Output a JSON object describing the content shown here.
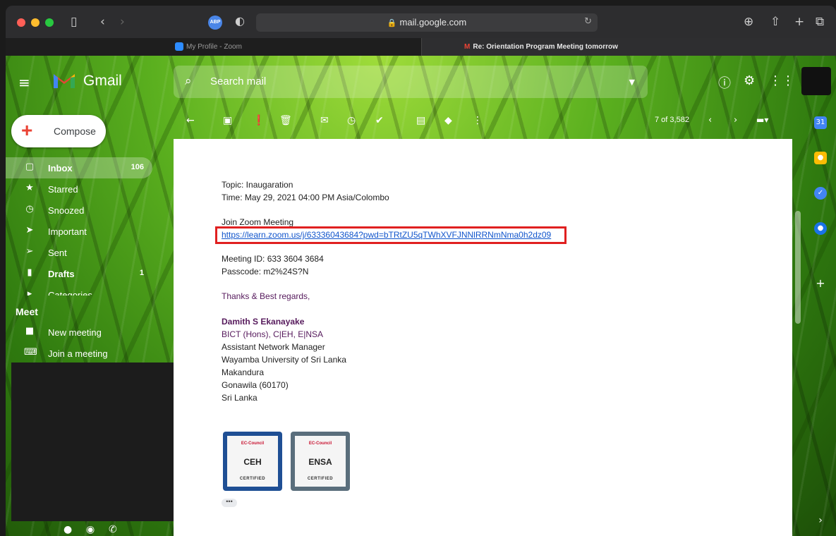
{
  "browser": {
    "url": "mail.google.com",
    "tabs": [
      {
        "label": "My Profile - Zoom"
      },
      {
        "label": "Re: Orientation Program Meeting tomorrow"
      }
    ]
  },
  "gmail": {
    "app_name": "Gmail",
    "search_placeholder": "Search mail",
    "compose_label": "Compose",
    "nav": [
      {
        "label": "Inbox",
        "count": "106",
        "icon": "inbox-icon"
      },
      {
        "label": "Starred",
        "count": "",
        "icon": "star-icon"
      },
      {
        "label": "Snoozed",
        "count": "",
        "icon": "clock-icon"
      },
      {
        "label": "Important",
        "count": "",
        "icon": "important-icon"
      },
      {
        "label": "Sent",
        "count": "",
        "icon": "send-icon"
      },
      {
        "label": "Drafts",
        "count": "1",
        "icon": "draft-icon"
      },
      {
        "label": "Categories",
        "count": "",
        "icon": "label-icon"
      }
    ],
    "meet": {
      "title": "Meet",
      "items": [
        {
          "label": "New meeting",
          "icon": "video-icon"
        },
        {
          "label": "Join a meeting",
          "icon": "keyboard-icon"
        }
      ]
    },
    "pagination": "7 of 3,582"
  },
  "email": {
    "topic": "Topic: Inaugaration",
    "time": "Time: May 29, 2021 04:00 PM Asia/Colombo",
    "join_label": "Join Zoom Meeting",
    "join_link": "https://learn.zoom.us/j/63336043684?pwd=bTRtZU5qTWhXVFJNNlRRNmNma0h2dz09",
    "meeting_id": "Meeting ID: 633 3604 3684",
    "passcode": "Passcode: m2%24S?N",
    "closing": "Thanks & Best regards,",
    "signature": {
      "name": "Damith S Ekanayake",
      "credentials": "BICT (Hons), C|EH, E|NSA",
      "lines": [
        "Assistant Network Manager",
        "Wayamba University of Sri Lanka",
        "Makandura",
        "Gonawila (60170)",
        "Sri Lanka"
      ]
    },
    "badges": [
      {
        "top": "EC-Council",
        "mid": "CEH",
        "cert": "CERTIFIED"
      },
      {
        "top": "EC-Council",
        "mid": "ENSA",
        "cert": "CERTIFIED"
      }
    ],
    "more": "•••"
  }
}
